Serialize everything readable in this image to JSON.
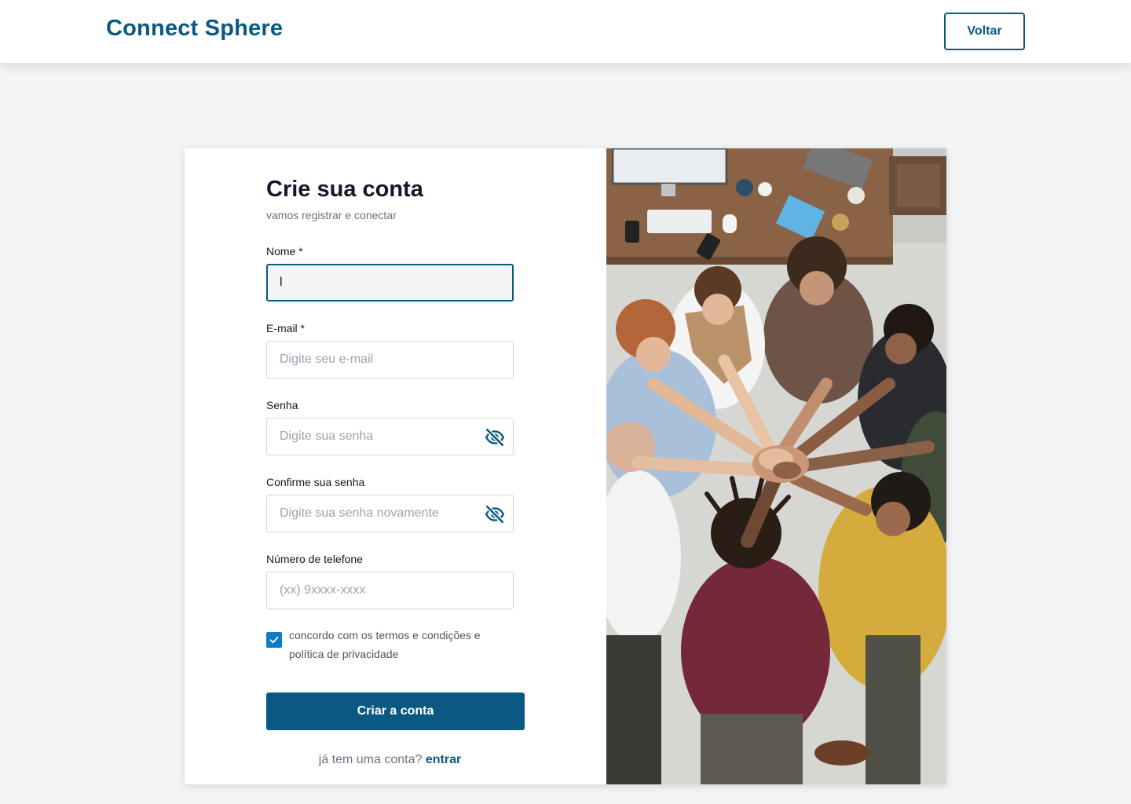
{
  "header": {
    "brand": "Connect Sphere",
    "back_label": "Voltar"
  },
  "form": {
    "title": "Crie sua conta",
    "subtitle": "vamos registrar e conectar",
    "name": {
      "label": "Nome *",
      "value": "l",
      "placeholder": ""
    },
    "email": {
      "label": "E-mail *",
      "value": "",
      "placeholder": "Digite seu e-mail"
    },
    "password": {
      "label": "Senha",
      "value": "",
      "placeholder": "Digite sua senha"
    },
    "confirm_password": {
      "label": "Confirme sua senha",
      "value": "",
      "placeholder": "Digite sua senha novamente"
    },
    "phone": {
      "label": "Número de telefone",
      "value": "",
      "placeholder": "(xx) 9xxxx-xxxx"
    },
    "terms": {
      "checked": true,
      "label": "concordo com os termos e condições e política de privacidade"
    },
    "submit_label": "Criar a conta",
    "login_prompt": "já tem uma conta?",
    "login_link": "entrar"
  },
  "image": {
    "subject": "team-hands-stacked-photo"
  },
  "icons": {
    "eye_toggle": "eye-off-icon",
    "check": "check-icon"
  },
  "colors": {
    "brand": "#0b5983",
    "checkbox": "#0c7dc4",
    "background": "#f3f4f6"
  }
}
